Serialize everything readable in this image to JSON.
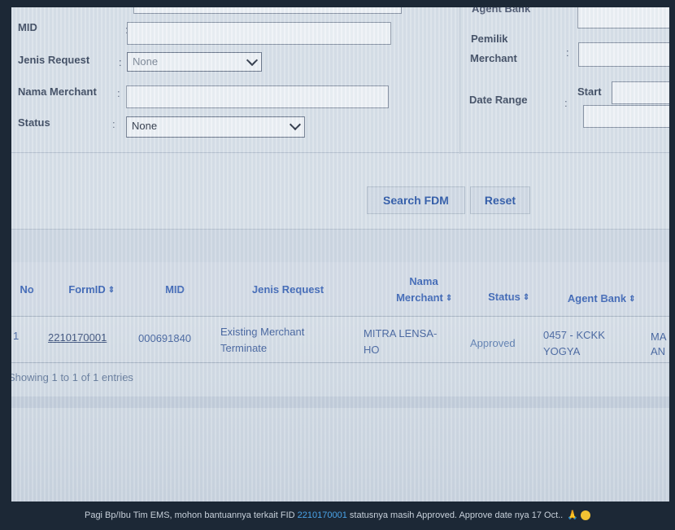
{
  "form": {
    "agent_bank_label": "Agent Bank",
    "mid_label": "MID",
    "jenis_request_label": "Jenis Request",
    "jenis_request_value": "None",
    "nama_merchant_label": "Nama Merchant",
    "status_label": "Status",
    "status_value": "None",
    "pemilik_label_1": "Pemilik",
    "pemilik_label_2": "Merchant",
    "date_range_label": "Date Range",
    "start_label": "Start",
    "colon": ":"
  },
  "buttons": {
    "search": "Search FDM",
    "reset": "Reset"
  },
  "table": {
    "headers": {
      "no": "No",
      "form_id": "FormID",
      "mid": "MID",
      "jenis_request": "Jenis Request",
      "nama_merchant_1": "Nama",
      "nama_merchant_2": "Merchant",
      "status": "Status",
      "agent_bank": "Agent Bank"
    },
    "rows": [
      {
        "no": "1",
        "form_id": "2210170001",
        "mid": "000691840",
        "jenis_request_1": "Existing Merchant",
        "jenis_request_2": "Terminate",
        "nama_merchant_1": "MITRA LENSA-",
        "nama_merchant_2": "HO",
        "status": "Approved",
        "agent_bank_1": "0457 - KCKK",
        "agent_bank_2": "YOGYA",
        "extra_1": "MA",
        "extra_2": "AN"
      }
    ],
    "footer": "Showing 1 to 1 of 1 entries"
  },
  "caption": {
    "before": "Pagi Bp/Ibu Tim EMS, mohon bantuannya terkait FID ",
    "fid": "2210170001",
    "after": " statusnya masih Approved. Approve date nya 17 Oct..",
    "icons": [
      "folded-hands-emoji",
      "smiling-face-emoji"
    ]
  }
}
